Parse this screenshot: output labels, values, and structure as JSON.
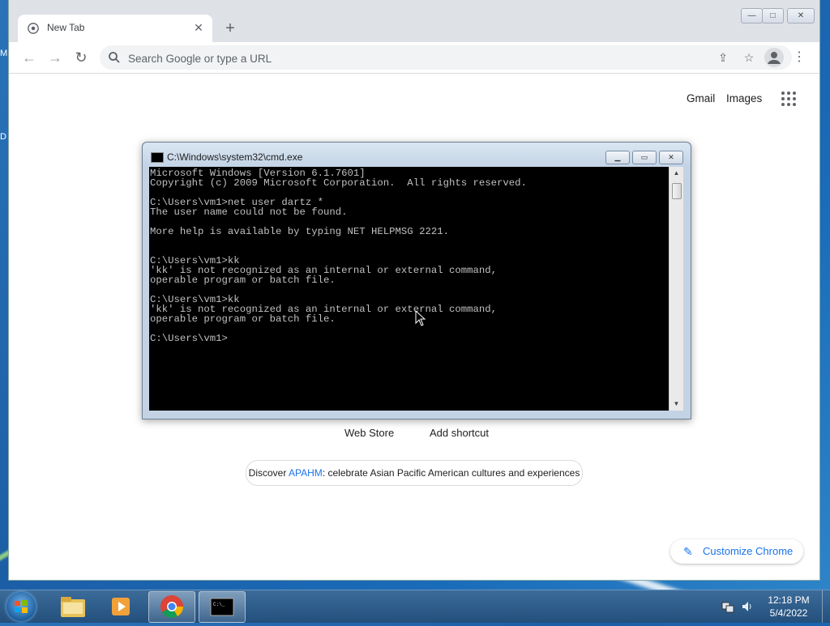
{
  "desktop": {
    "letters": [
      "M",
      "D"
    ]
  },
  "chrome": {
    "tab": {
      "title": "New Tab"
    },
    "window_controls": {
      "minimize": "—",
      "maximize": "□",
      "close": "✕"
    },
    "toolbar": {
      "back": "←",
      "forward": "→",
      "reload": "↻",
      "omnibox_placeholder": "Search Google or type a URL",
      "menu": "⋮"
    },
    "ntp": {
      "gmail": "Gmail",
      "images": "Images",
      "shortcuts": [
        "Web Store",
        "Add shortcut"
      ],
      "promo": {
        "prefix": "Discover ",
        "link": "APAHM",
        "suffix": ": celebrate Asian Pacific American cultures and experiences"
      },
      "customize": "Customize Chrome"
    }
  },
  "cmd": {
    "title": "C:\\Windows\\system32\\cmd.exe",
    "lines": [
      "Microsoft Windows [Version 6.1.7601]",
      "Copyright (c) 2009 Microsoft Corporation.  All rights reserved.",
      "",
      "C:\\Users\\vm1>net user dartz *",
      "The user name could not be found.",
      "",
      "More help is available by typing NET HELPMSG 2221.",
      "",
      "",
      "C:\\Users\\vm1>kk",
      "'kk' is not recognized as an internal or external command,",
      "operable program or batch file.",
      "",
      "C:\\Users\\vm1>kk",
      "'kk' is not recognized as an internal or external command,",
      "operable program or batch file.",
      "",
      "C:\\Users\\vm1>"
    ]
  },
  "taskbar": {
    "items": [
      "start-button",
      "explorer",
      "media-player",
      "chrome",
      "cmd"
    ],
    "clock": {
      "time": "12:18 PM",
      "date": "5/4/2022"
    }
  },
  "colors": {
    "accent": "#1a73e8",
    "console_bg": "#000000",
    "console_fg": "#c0c0c0"
  }
}
